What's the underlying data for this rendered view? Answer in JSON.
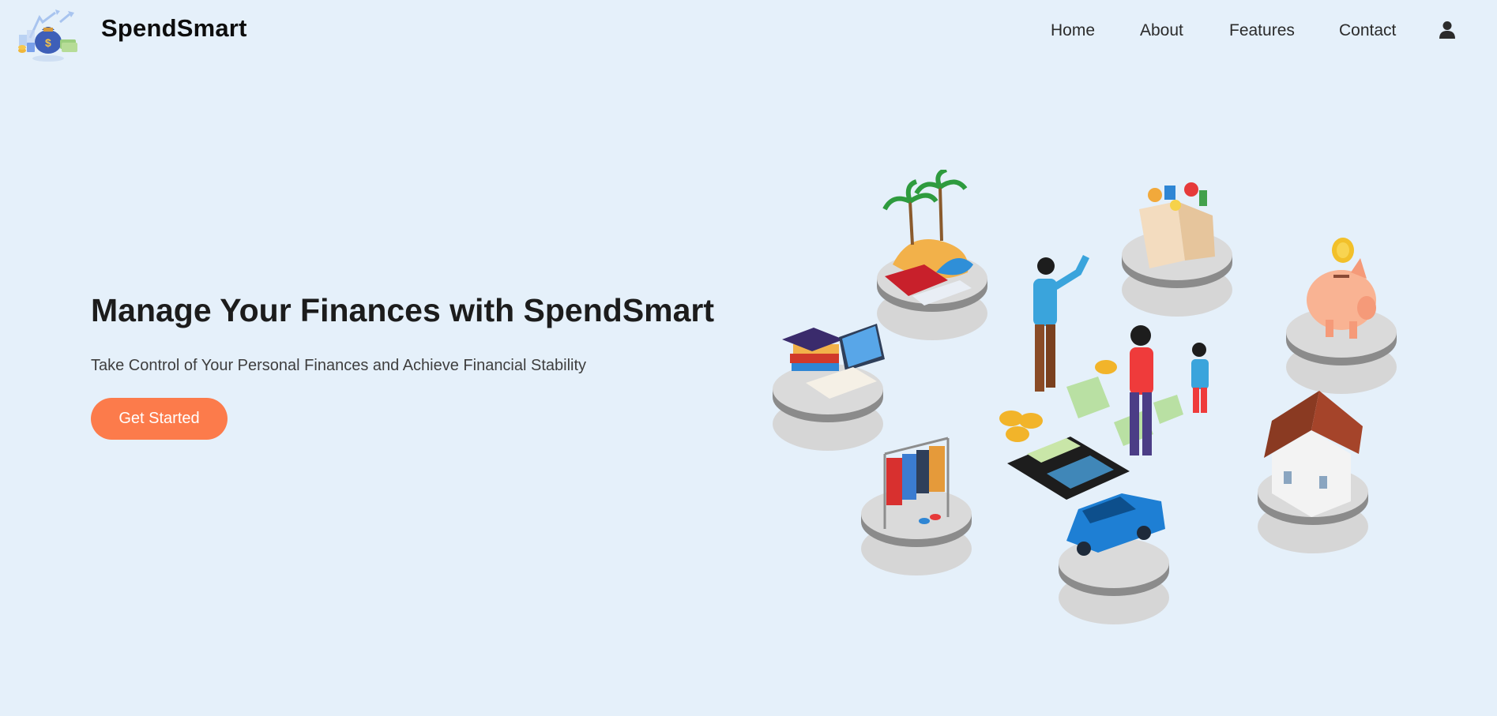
{
  "header": {
    "brand": "SpendSmart",
    "logo_icon": "money-bag-logo-icon",
    "nav": [
      {
        "label": "Home"
      },
      {
        "label": "About"
      },
      {
        "label": "Features"
      },
      {
        "label": "Contact"
      }
    ],
    "user_icon": "user-icon"
  },
  "hero": {
    "title": "Manage Your Finances with SpendSmart",
    "subtitle": "Take Control of Your Personal Finances and Achieve Financial Stability",
    "cta_label": "Get Started",
    "illustration_icon": "finance-isometric-illustration"
  },
  "colors": {
    "background": "#e5f0fa",
    "accent": "#fc7b4b",
    "text": "#1c1c1c"
  }
}
